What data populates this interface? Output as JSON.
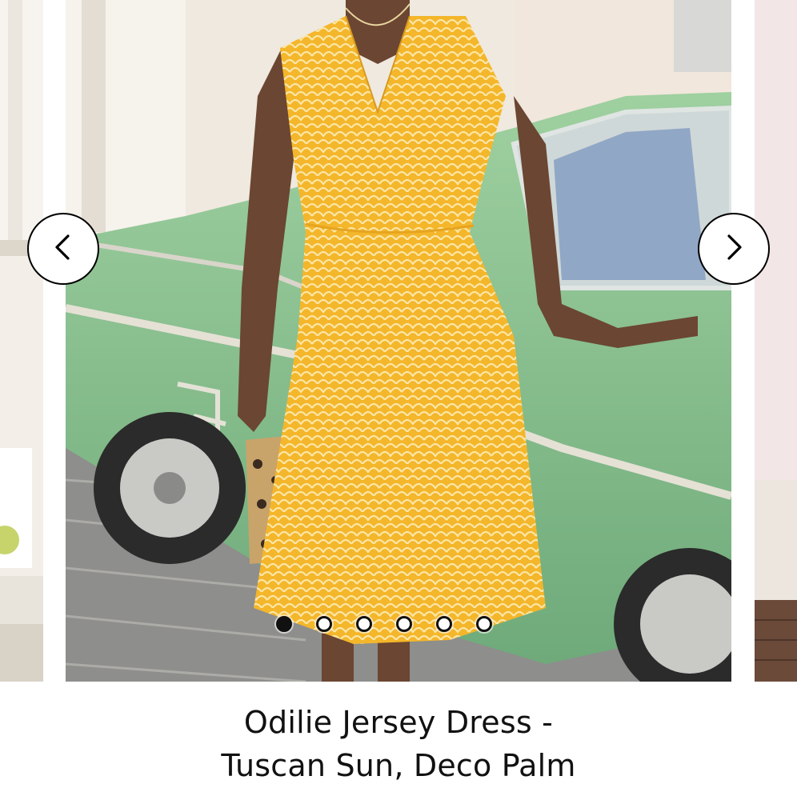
{
  "carousel": {
    "image": {
      "icon": "product-photo-woman-yellow-dress-green-car",
      "colors": {
        "dress": "#f2b82e",
        "car": "#8fc48f",
        "sky": "#ece6d8"
      }
    },
    "prev_icon": "chevron-left-icon",
    "next_icon": "chevron-right-icon",
    "current_slide": 1,
    "total_slides": 6,
    "dots": [
      {
        "active": true
      },
      {
        "active": false
      },
      {
        "active": false
      },
      {
        "active": false
      },
      {
        "active": false
      },
      {
        "active": false
      }
    ]
  },
  "product": {
    "title_line1": "Odilie Jersey Dress -",
    "title_line2": "Tuscan Sun, Deco Palm"
  }
}
